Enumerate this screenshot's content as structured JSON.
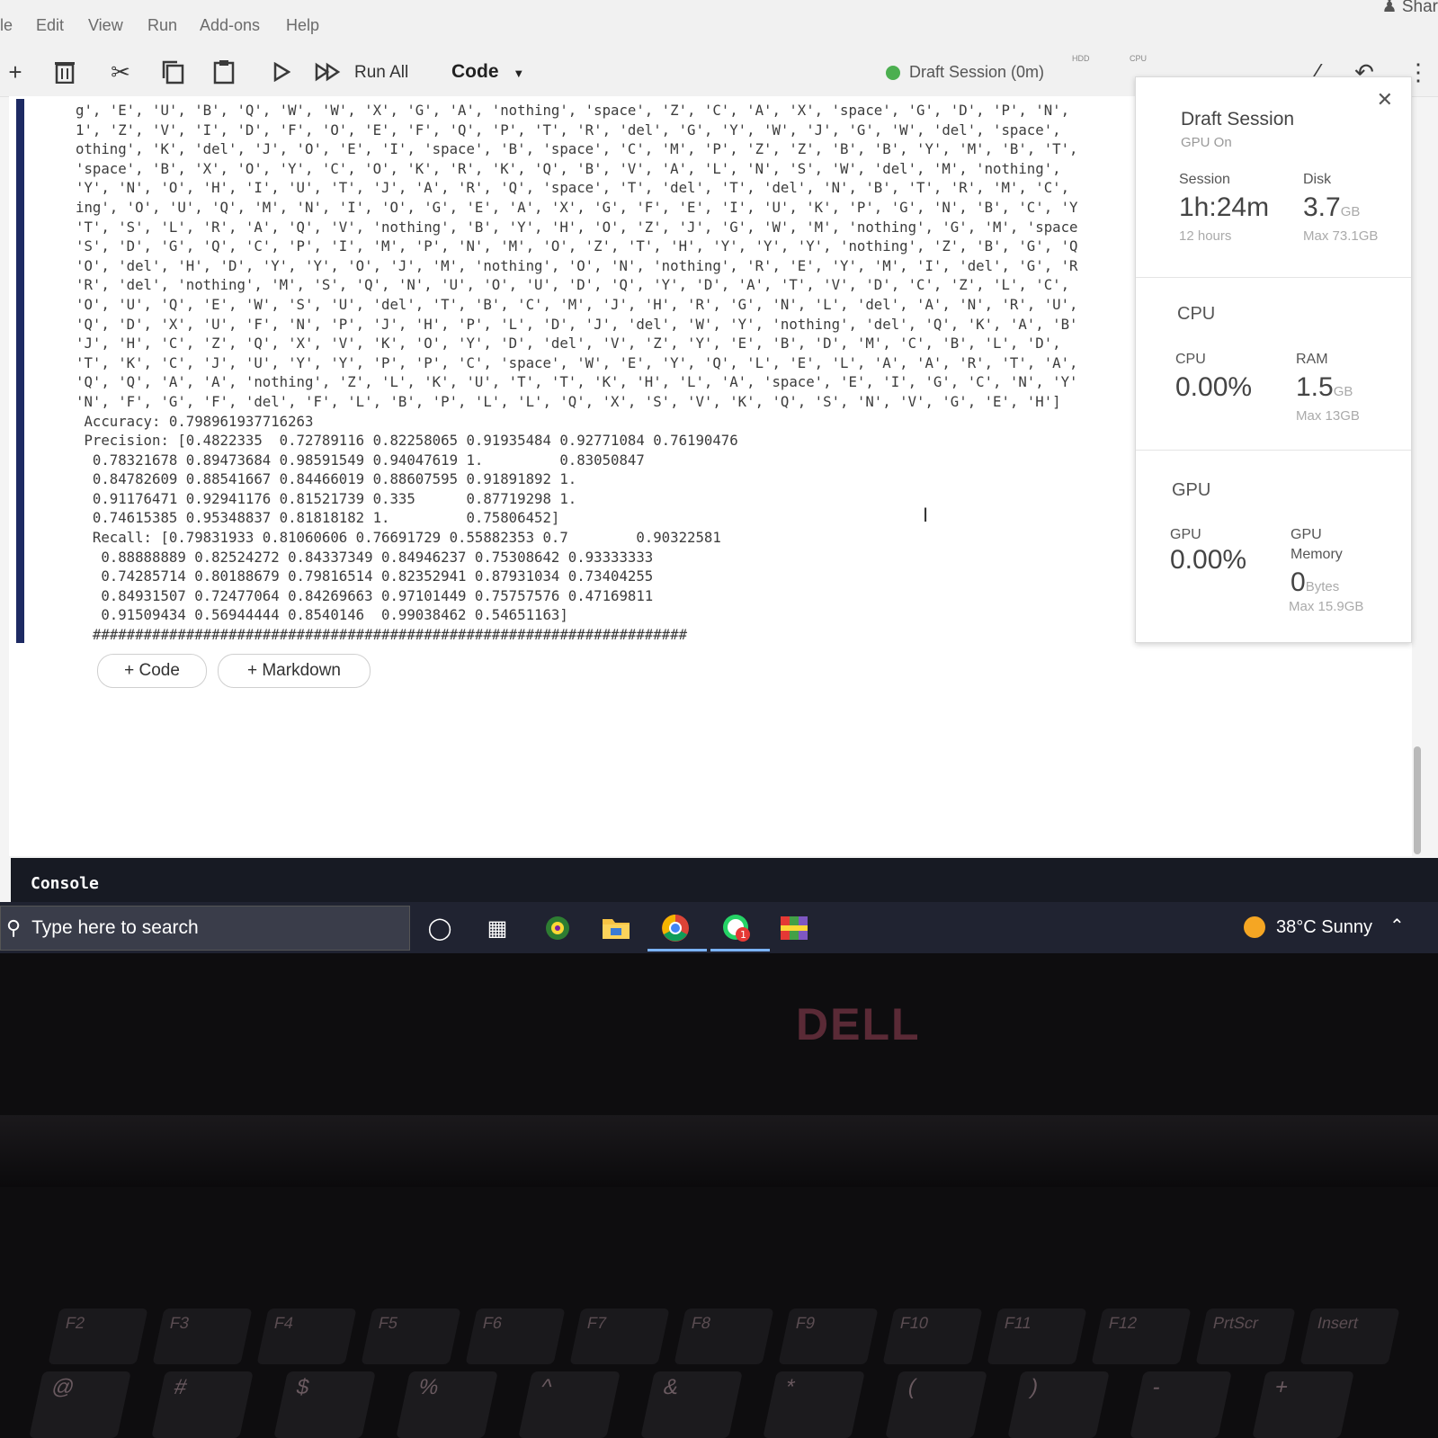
{
  "menu": [
    "le",
    "Edit",
    "View",
    "Run",
    "Add-ons",
    "Help"
  ],
  "share_label": "Shar",
  "toolbar": {
    "run_all": "Run All",
    "cell_type": "Code",
    "session_status": "Draft Session (0m)",
    "tab_hdd": "HDD",
    "tab_cpu": "CPU"
  },
  "output_lines": [
    "g', 'E', 'U', 'B', 'Q', 'W', 'W', 'X', 'G', 'A', 'nothing', 'space', 'Z', 'C', 'A', 'X', 'space', 'G', 'D', 'P', 'N',",
    "1', 'Z', 'V', 'I', 'D', 'F', 'O', 'E', 'F', 'Q', 'P', 'T', 'R', 'del', 'G', 'Y', 'W', 'J', 'G', 'W', 'del', 'space',",
    "othing', 'K', 'del', 'J', 'O', 'E', 'I', 'space', 'B', 'space', 'C', 'M', 'P', 'Z', 'Z', 'B', 'B', 'Y', 'M', 'B', 'T',",
    "'space', 'B', 'X', 'O', 'Y', 'C', 'O', 'K', 'R', 'K', 'Q', 'B', 'V', 'A', 'L', 'N', 'S', 'W', 'del', 'M', 'nothing',",
    "'Y', 'N', 'O', 'H', 'I', 'U', 'T', 'J', 'A', 'R', 'Q', 'space', 'T', 'del', 'T', 'del', 'N', 'B', 'T', 'R', 'M', 'C',",
    "ing', 'O', 'U', 'Q', 'M', 'N', 'I', 'O', 'G', 'E', 'A', 'X', 'G', 'F', 'E', 'I', 'U', 'K', 'P', 'G', 'N', 'B', 'C', 'Y",
    "'T', 'S', 'L', 'R', 'A', 'Q', 'V', 'nothing', 'B', 'Y', 'H', 'O', 'Z', 'J', 'G', 'W', 'M', 'nothing', 'G', 'M', 'space",
    "'S', 'D', 'G', 'Q', 'C', 'P', 'I', 'M', 'P', 'N', 'M', 'O', 'Z', 'T', 'H', 'Y', 'Y', 'Y', 'nothing', 'Z', 'B', 'G', 'Q",
    "'O', 'del', 'H', 'D', 'Y', 'Y', 'O', 'J', 'M', 'nothing', 'O', 'N', 'nothing', 'R', 'E', 'Y', 'M', 'I', 'del', 'G', 'R",
    "'R', 'del', 'nothing', 'M', 'S', 'Q', 'N', 'U', 'O', 'U', 'D', 'Q', 'Y', 'D', 'A', 'T', 'V', 'D', 'C', 'Z', 'L', 'C',",
    "'O', 'U', 'Q', 'E', 'W', 'S', 'U', 'del', 'T', 'B', 'C', 'M', 'J', 'H', 'R', 'G', 'N', 'L', 'del', 'A', 'N', 'R', 'U',",
    "'Q', 'D', 'X', 'U', 'F', 'N', 'P', 'J', 'H', 'P', 'L', 'D', 'J', 'del', 'W', 'Y', 'nothing', 'del', 'Q', 'K', 'A', 'B'",
    "'J', 'H', 'C', 'Z', 'Q', 'X', 'V', 'K', 'O', 'Y', 'D', 'del', 'V', 'Z', 'Y', 'E', 'B', 'D', 'M', 'C', 'B', 'L', 'D',",
    "'T', 'K', 'C', 'J', 'U', 'Y', 'Y', 'P', 'P', 'C', 'space', 'W', 'E', 'Y', 'Q', 'L', 'E', 'L', 'A', 'A', 'R', 'T', 'A',",
    "'Q', 'Q', 'A', 'A', 'nothing', 'Z', 'L', 'K', 'U', 'T', 'T', 'K', 'H', 'L', 'A', 'space', 'E', 'I', 'G', 'C', 'N', 'Y'",
    "'N', 'F', 'G', 'F', 'del', 'F', 'L', 'B', 'P', 'L', 'L', 'Q', 'X', 'S', 'V', 'K', 'Q', 'S', 'N', 'V', 'G', 'E', 'H']",
    " Accuracy: 0.798961937716263",
    " Precision: [0.4822335  0.72789116 0.82258065 0.91935484 0.92771084 0.76190476",
    "  0.78321678 0.89473684 0.98591549 0.94047619 1.         0.83050847",
    "  0.84782609 0.88541667 0.84466019 0.88607595 0.91891892 1.",
    "  0.91176471 0.92941176 0.81521739 0.335      0.87719298 1.",
    "  0.74615385 0.95348837 0.81818182 1.         0.75806452]",
    "  Recall: [0.79831933 0.81060606 0.76691729 0.55882353 0.7        0.90322581",
    "   0.88888889 0.82524272 0.84337349 0.84946237 0.75308642 0.93333333",
    "   0.74285714 0.80188679 0.79816514 0.82352941 0.87931034 0.73404255",
    "   0.84931507 0.72477064 0.84269663 0.97101449 0.75757576 0.47169811",
    "   0.91509434 0.56944444 0.8540146  0.99038462 0.54651163]",
    "  ######################################################################"
  ],
  "add_cell": {
    "code": "+ Code",
    "markdown": "+ Markdown"
  },
  "session_panel": {
    "title": "Draft Session",
    "subtitle": "GPU On",
    "session_label": "Session",
    "session_value": "1h:24m",
    "session_max": "12 hours",
    "disk_label": "Disk",
    "disk_value": "3.7",
    "disk_unit": "GB",
    "disk_max": "Max 73.1GB",
    "cpu_section": "CPU",
    "cpu_label": "CPU",
    "cpu_value": "0.00%",
    "ram_label": "RAM",
    "ram_value": "1.5",
    "ram_unit": "GB",
    "ram_max": "Max 13GB",
    "gpu_section": "GPU",
    "gpu_label": "GPU",
    "gpu_value": "0.00%",
    "gpu_mem_label1": "GPU",
    "gpu_mem_label2": "Memory",
    "gpu_mem_value": "0",
    "gpu_mem_unit": "Bytes",
    "gpu_mem_max": "Max 15.9GB"
  },
  "console_label": "Console",
  "taskbar": {
    "search_placeholder": "Type here to search",
    "weather": "38°C Sunny"
  },
  "laptop_brand": "DELL",
  "fkeys": [
    "F2",
    "F3",
    "F4",
    "F5",
    "F6",
    "F7",
    "F8",
    "F9",
    "F10",
    "F11",
    "F12",
    "PrtScr",
    "Insert"
  ],
  "numkeys": [
    "@",
    "#",
    "$",
    "%",
    "^",
    "&",
    "*",
    "(",
    ")",
    "-",
    "+"
  ],
  "colors": {
    "cell_bar": "#1d2a63",
    "session_dot": "#4caf50",
    "taskbar_bg": "#202331",
    "console_bg": "#171a23"
  }
}
